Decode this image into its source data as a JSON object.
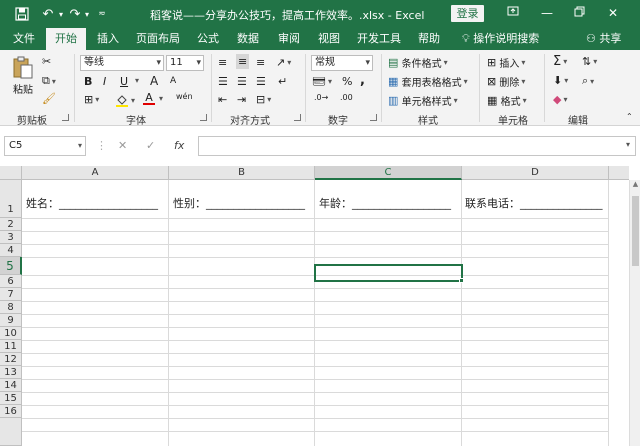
{
  "titlebar": {
    "save_icon": "save-icon",
    "undo_icon": "undo-icon",
    "redo_icon": "redo-icon",
    "customize_icon": "customize-qat-icon",
    "title": "稻客说——分享办公技巧，提高工作效率。.xlsx  -  Excel",
    "login": "登录"
  },
  "tabs": [
    {
      "label": "文件"
    },
    {
      "label": "开始"
    },
    {
      "label": "插入"
    },
    {
      "label": "页面布局"
    },
    {
      "label": "公式"
    },
    {
      "label": "数据"
    },
    {
      "label": "审阅"
    },
    {
      "label": "视图"
    },
    {
      "label": "开发工具"
    },
    {
      "label": "帮助"
    }
  ],
  "tell_me": "操作说明搜索",
  "share": "共享",
  "ribbon": {
    "clipboard": {
      "paste": "粘贴",
      "label": "剪贴板"
    },
    "font": {
      "name": "等线",
      "size": "11",
      "bold": "B",
      "italic": "I",
      "underline": "U",
      "grow": "A",
      "shrink": "A",
      "color_a": "A",
      "phonetic": "wén",
      "label": "字体"
    },
    "alignment": {
      "label": "对齐方式"
    },
    "number": {
      "format": "常规",
      "percent": "%",
      "comma": ",",
      "label": "数字"
    },
    "styles": {
      "conditional": "条件格式",
      "table": "套用表格格式",
      "cell": "单元格样式",
      "label": "样式"
    },
    "cells": {
      "insert": "插入",
      "delete": "删除",
      "format": "格式",
      "label": "单元格"
    },
    "editing": {
      "label": "编辑"
    }
  },
  "formula_bar": {
    "name_box": "C5",
    "fx": "fx",
    "value": ""
  },
  "columns": [
    "A",
    "B",
    "C",
    "D"
  ],
  "rows": [
    "1",
    "2",
    "3",
    "4",
    "5",
    "6",
    "7",
    "8",
    "9",
    "10",
    "11",
    "12",
    "13",
    "14",
    "15",
    "16"
  ],
  "selected": {
    "col": "C",
    "row": "5"
  },
  "cells": {
    "A1": "姓名：__________________",
    "B1": "性别：__________________",
    "C1": "年龄：__________________",
    "D1": "联系电话：_______________"
  },
  "colors": {
    "accent": "#217346",
    "ribbon_bg": "#f3f3f3",
    "grid_line": "#dadada"
  }
}
